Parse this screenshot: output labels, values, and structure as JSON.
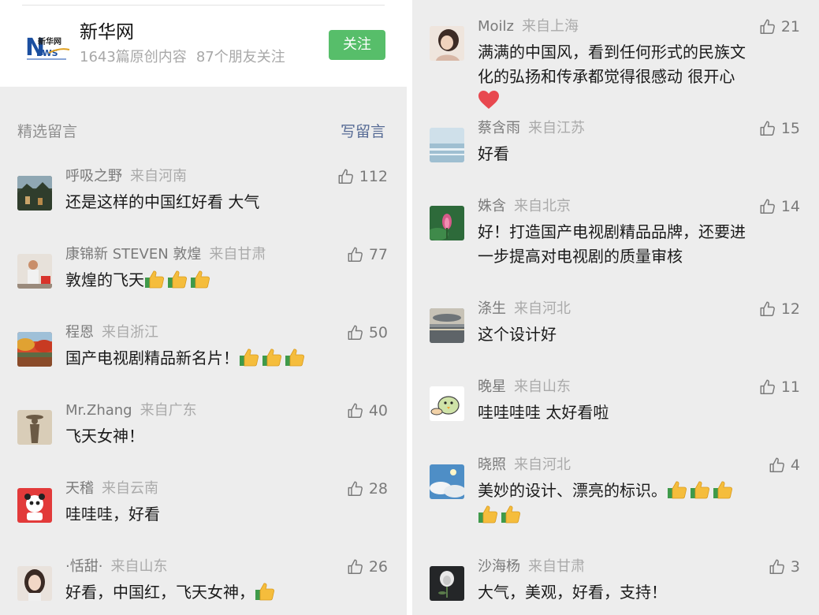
{
  "account": {
    "name": "新华网",
    "logo_text": "新华网",
    "original_count": "1643篇原创内容",
    "friends_follow": "87个朋友关注",
    "follow_label": "关注"
  },
  "comments_section": {
    "title": "精选留言",
    "write_label": "写留言"
  },
  "colors": {
    "follow_green": "#57be6a",
    "link_blue": "#576b95",
    "panel_bg": "#ededed"
  },
  "left_comments": [
    {
      "author": "呼吸之野",
      "location": "来自河南",
      "likes": "112",
      "text": "还是这样的中国红好看 大气",
      "emoji": [],
      "avatar": "mountain-photo"
    },
    {
      "author": "康锦新 STEVEN 敦煌",
      "location": "来自甘肃",
      "likes": "77",
      "text": "敦煌的飞天",
      "emoji": [
        "thumbs-up",
        "thumbs-up",
        "thumbs-up"
      ],
      "avatar": "person-photo"
    },
    {
      "author": "程恩",
      "location": "来自浙江",
      "likes": "50",
      "text": "国产电视剧精品新名片！",
      "emoji": [
        "thumbs-up",
        "thumbs-up",
        "thumbs-up"
      ],
      "avatar": "autumn-lake-photo"
    },
    {
      "author": "Mr.Zhang",
      "location": "来自广东",
      "likes": "40",
      "text": "飞天女神！",
      "emoji": [],
      "avatar": "silhouette-photo"
    },
    {
      "author": "天稽",
      "location": "来自云南",
      "likes": "28",
      "text": "哇哇哇，好看",
      "emoji": [],
      "avatar": "cartoon-panda"
    },
    {
      "author": "·恬甜·",
      "location": "来自山东",
      "likes": "26",
      "text": "好看，中国红，飞天女神，",
      "emoji": [
        "thumbs-up"
      ],
      "avatar": "girl-photo"
    }
  ],
  "right_comments": [
    {
      "author": "Moilz",
      "location": "来自上海",
      "likes": "21",
      "text": "满满的中国风，看到任何形式的民族文化的弘扬和传承都觉得很感动 很开心",
      "emoji": [
        "heart"
      ],
      "avatar": "portrait-photo"
    },
    {
      "author": "蔡含雨",
      "location": "来自江苏",
      "likes": "15",
      "text": "好看",
      "emoji": [],
      "avatar": "sea-photo"
    },
    {
      "author": "姝含",
      "location": "来自北京",
      "likes": "14",
      "text": "好！打造国产电视剧精品品牌，还要进一步提高对电视剧的质量审核",
      "emoji": [],
      "avatar": "lotus-photo"
    },
    {
      "author": "涤生",
      "location": "来自河北",
      "likes": "12",
      "text": "这个设计好",
      "emoji": [],
      "avatar": "sunset-photo"
    },
    {
      "author": "晚星",
      "location": "来自山东",
      "likes": "11",
      "text": "哇哇哇哇 太好看啦",
      "emoji": [],
      "avatar": "cartoon-bird"
    },
    {
      "author": "晓照",
      "location": "来自河北",
      "likes": "4",
      "text": "美妙的设计、漂亮的标识。",
      "emoji": [
        "thumbs-up",
        "thumbs-up",
        "thumbs-up",
        "thumbs-up",
        "thumbs-up"
      ],
      "avatar": "sky-photo"
    },
    {
      "author": "沙海杨",
      "location": "来自甘肃",
      "likes": "3",
      "text": "大气，美观，好看，支持！",
      "emoji": [],
      "avatar": "flower-photo"
    }
  ]
}
